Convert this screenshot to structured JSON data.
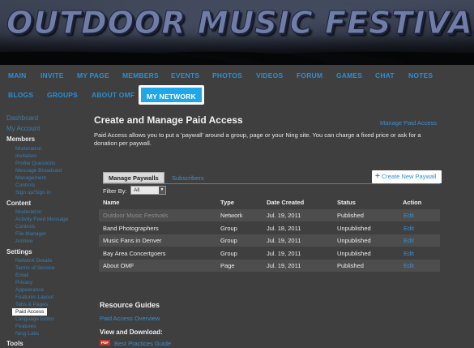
{
  "banner": {
    "title": "OUTDOOR MUSIC FESTIVALS"
  },
  "nav": {
    "row1": [
      "MAIN",
      "INVITE",
      "MY PAGE",
      "MEMBERS",
      "EVENTS",
      "PHOTOS",
      "VIDEOS",
      "FORUM",
      "GAMES",
      "CHAT",
      "NOTES"
    ],
    "row2": [
      "BLOGS",
      "GROUPS",
      "ABOUT OMF",
      "MY NETWORK"
    ],
    "active": "MY NETWORK"
  },
  "sidebar": {
    "dashboard": "Dashboard",
    "my_account": "My Account",
    "members": {
      "heading": "Members",
      "items": [
        "Moderation",
        "Invitation",
        "Profile Questions",
        "Message Broadcast",
        "Management",
        "Controls",
        "Sign up/Sign in"
      ]
    },
    "content": {
      "heading": "Content",
      "items": [
        "Moderation",
        "Activity Feed Message",
        "Controls",
        "File Manager",
        "Archive"
      ]
    },
    "settings": {
      "heading": "Settings",
      "items": [
        "Network Details",
        "Terms of Service",
        "Email",
        "Privacy",
        "Appearance",
        "Features Layout",
        "Tabs & Pages",
        "Paid Access",
        "Language Editor",
        "Features",
        "Ning Labs"
      ],
      "current": "Paid Access"
    },
    "tools": {
      "heading": "Tools"
    }
  },
  "main": {
    "title": "Create and Manage Paid Access",
    "manage_link": "Manage Paid Access",
    "description": "Paid Access allows you to put a 'paywall' around a group, page or your Ning site. You can charge a fixed price or ask for a donation per paywall.",
    "tabs": {
      "manage": "Manage Paywalls",
      "subscribers": "Subscribers"
    },
    "create_button": "Create New Paywall",
    "filter": {
      "label": "Filter By:",
      "value": "All"
    },
    "table": {
      "headers": {
        "name": "Name",
        "type": "Type",
        "date": "Date Created",
        "status": "Status",
        "action": "Action"
      },
      "rows": [
        {
          "name": "Outdoor Music Festivals",
          "type": "Network",
          "date": "Jul. 19, 2011",
          "status": "Published",
          "action": "Edit"
        },
        {
          "name": "Band Photographers",
          "type": "Group",
          "date": "Jul. 18, 2011",
          "status": "Unpublished",
          "action": "Edit"
        },
        {
          "name": "Music Fans in Denver",
          "type": "Group",
          "date": "Jul. 19, 2011",
          "status": "Unpublished",
          "action": "Edit"
        },
        {
          "name": "Bay Area Concertgoers",
          "type": "Group",
          "date": "Jul. 19, 2011",
          "status": "Unpublished",
          "action": "Edit"
        },
        {
          "name": "About OMF",
          "type": "Page",
          "date": "Jul. 19, 2011",
          "status": "Published",
          "action": "Edit"
        }
      ]
    },
    "resources": {
      "title": "Resource Guides",
      "overview_link": "Paid Access Overview",
      "view_title": "View and Download:",
      "pdf_badge": "PDF",
      "best_practices": "Best Practices Guide"
    }
  },
  "colors": {
    "link": "#3b8fd0",
    "active_tab": "#20a7ea",
    "background": "#3f3f3f"
  }
}
